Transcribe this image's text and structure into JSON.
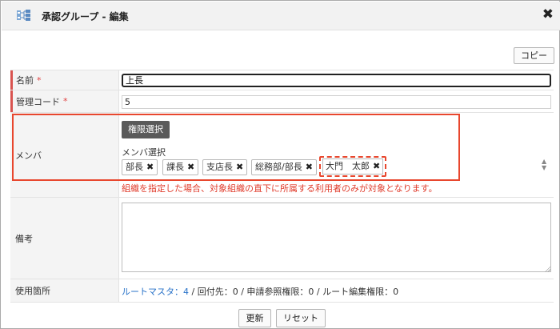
{
  "dialog": {
    "title": "承認グループ - 編集",
    "close_glyph": "✖",
    "copy_label": "コピー"
  },
  "fields": {
    "name": {
      "label": "名前",
      "required_mark": "*",
      "value": "上長"
    },
    "code": {
      "label": "管理コード",
      "required_mark": "*",
      "value": "5"
    },
    "members": {
      "label": "メンバ",
      "permission_button": "権限選択",
      "select_label": "メンバ選択",
      "chips": [
        "部長",
        "課長",
        "支店長",
        "総務部/部長",
        "大門　太郎"
      ],
      "remove_glyph": "✖",
      "note": "組織を指定した場合、対象組織の直下に所属する利用者のみが対象となります。"
    },
    "remarks": {
      "label": "備考",
      "value": ""
    },
    "usage": {
      "label": "使用箇所",
      "route_master_link": "ルートマスタ：4",
      "rest": " / 回付先：0 / 申請参照権限：0 / ルート編集権限：0"
    }
  },
  "footer": {
    "update_label": "更新",
    "reset_label": "リセット"
  },
  "colors": {
    "highlight": "#e8472e",
    "required_bar": "#d9534f",
    "link": "#2a73c9"
  },
  "icons": {
    "title": "org-chart-icon",
    "close": "close-icon",
    "chip_remove": "remove-icon",
    "scroll": "scroll-arrows-icon"
  }
}
